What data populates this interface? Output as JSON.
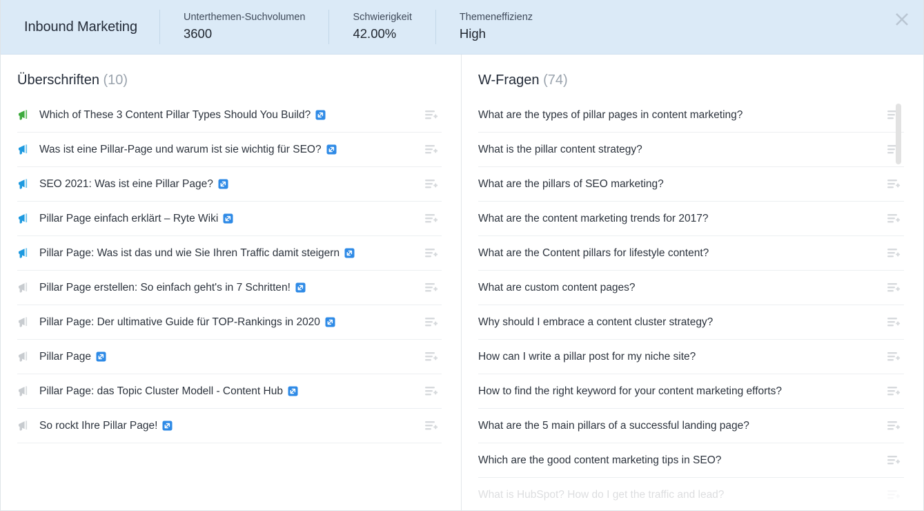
{
  "header": {
    "title": "Inbound Marketing",
    "metrics": [
      {
        "label": "Unterthemen-Suchvolumen",
        "value": "3600"
      },
      {
        "label": "Schwierigkeit",
        "value": "42.00%"
      },
      {
        "label": "Themeneffizienz",
        "value": "High"
      }
    ],
    "close_label": "×"
  },
  "colors": {
    "header_bg": "#dbeaf7",
    "accent_link": "#2e8ae6",
    "megaphone_green": "#3eab3e",
    "megaphone_blue": "#1e9ae0",
    "megaphone_gray": "#c8ccd0",
    "action_icon": "#d6d9dc"
  },
  "left_panel": {
    "title": "Überschriften",
    "count": "(10)",
    "items": [
      {
        "text": "Which of These 3 Content Pillar Types Should You Build?",
        "icon": "megaphone-icon",
        "icon_color": "green",
        "has_link": true
      },
      {
        "text": "Was ist eine Pillar-Page und warum ist sie wichtig für SEO?",
        "icon": "megaphone-icon",
        "icon_color": "blue",
        "has_link": true
      },
      {
        "text": "SEO 2021: Was ist eine Pillar Page?",
        "icon": "megaphone-icon",
        "icon_color": "blue",
        "has_link": true
      },
      {
        "text": "Pillar Page einfach erklärt – Ryte Wiki",
        "icon": "megaphone-icon",
        "icon_color": "blue",
        "has_link": true
      },
      {
        "text": "Pillar Page: Was ist das und wie Sie Ihren Traffic damit steigern",
        "icon": "megaphone-icon",
        "icon_color": "blue",
        "has_link": true
      },
      {
        "text": "Pillar Page erstellen: So einfach geht's in 7 Schritten!",
        "icon": "megaphone-icon",
        "icon_color": "gray",
        "has_link": true
      },
      {
        "text": "Pillar Page: Der ultimative Guide für TOP-Rankings in 2020",
        "icon": "megaphone-icon",
        "icon_color": "gray",
        "has_link": true
      },
      {
        "text": "Pillar Page",
        "icon": "megaphone-icon",
        "icon_color": "gray",
        "has_link": true
      },
      {
        "text": "Pillar Page: das Topic Cluster Modell - Content Hub",
        "icon": "megaphone-icon",
        "icon_color": "gray",
        "has_link": true
      },
      {
        "text": "So rockt Ihre Pillar Page!",
        "icon": "megaphone-icon",
        "icon_color": "gray",
        "has_link": true
      }
    ]
  },
  "right_panel": {
    "title": "W-Fragen",
    "count": "(74)",
    "items": [
      {
        "text": "What are the types of pillar pages in content marketing?",
        "faded": false
      },
      {
        "text": "What is the pillar content strategy?",
        "faded": false
      },
      {
        "text": "What are the pillars of SEO marketing?",
        "faded": false
      },
      {
        "text": "What are the content marketing trends for 2017?",
        "faded": false
      },
      {
        "text": "What are the Content pillars for lifestyle content?",
        "faded": false
      },
      {
        "text": "What are custom content pages?",
        "faded": false
      },
      {
        "text": "Why should I embrace a content cluster strategy?",
        "faded": false
      },
      {
        "text": "How can I write a pillar post for my niche site?",
        "faded": false
      },
      {
        "text": "How to find the right keyword for your content marketing efforts?",
        "faded": false
      },
      {
        "text": "What are the 5 main pillars of a successful landing page?",
        "faded": false
      },
      {
        "text": "Which are the good content marketing tips in SEO?",
        "faded": false
      },
      {
        "text": "What is HubSpot? How do I get the traffic and lead?",
        "faded": true
      }
    ]
  }
}
